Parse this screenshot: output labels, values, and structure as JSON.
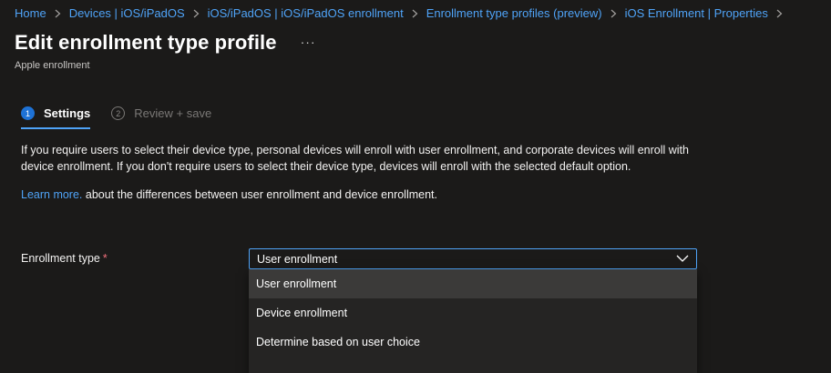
{
  "breadcrumb": [
    "Home",
    "Devices | iOS/iPadOS",
    "iOS/iPadOS | iOS/iPadOS enrollment",
    "Enrollment type profiles (preview)",
    "iOS Enrollment | Properties"
  ],
  "header": {
    "title": "Edit enrollment type profile",
    "more_label": "···",
    "subtitle": "Apple enrollment"
  },
  "wizard": {
    "steps": [
      {
        "number": "1",
        "label": "Settings",
        "active": true
      },
      {
        "number": "2",
        "label": "Review + save",
        "active": false
      }
    ]
  },
  "content": {
    "description": "If you require users to select their device type, personal devices will enroll with user enrollment, and corporate devices will enroll with device enrollment. If you don't require users to select their device type, devices will enroll with the selected default option.",
    "learn_more_link": "Learn more.",
    "learn_more_rest": " about the differences between user enrollment and device enrollment."
  },
  "form": {
    "enrollment_type_label": "Enrollment type",
    "required_marker": "*",
    "selected_value": "User enrollment",
    "options": [
      "User enrollment",
      "Device enrollment",
      "Determine based on user choice"
    ]
  },
  "colors": {
    "background": "#1b1a19",
    "accent": "#4fa3f7",
    "active_step": "#1e72d6",
    "required": "#f1707b",
    "dropdown_bg": "#252423",
    "selected_option_bg": "#3b3a39"
  },
  "icons": {
    "separator": "chevron-right-icon",
    "dropdown": "chevron-down-icon",
    "more": "ellipsis-icon"
  }
}
